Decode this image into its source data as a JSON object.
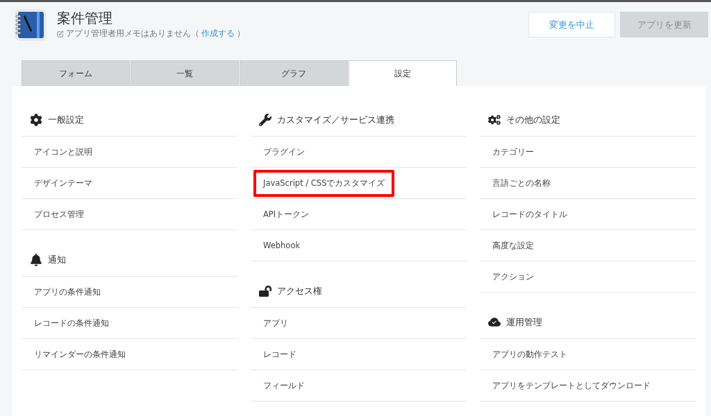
{
  "header": {
    "title": "案件管理",
    "memo": {
      "text": "アプリ管理者用メモはありません（",
      "link": "作成する",
      "suffix": "）"
    }
  },
  "buttons": [
    {
      "label": "変更を中止",
      "disabled": false
    },
    {
      "label": "アプリを更新",
      "disabled": true
    }
  ],
  "tabs": [
    {
      "label": "フォーム",
      "selected": false
    },
    {
      "label": "一覧",
      "selected": false
    },
    {
      "label": "グラフ",
      "selected": false
    },
    {
      "label": "設定",
      "selected": true
    }
  ],
  "columns": [
    {
      "sections": [
        {
          "title": "一般設定",
          "items": [
            {
              "label": "アイコンと説明",
              "highlighted": false
            },
            {
              "label": "デザインテーマ",
              "highlighted": false
            },
            {
              "label": "プロセス管理",
              "highlighted": false
            }
          ]
        },
        {
          "title": "通知",
          "items": [
            {
              "label": "アプリの条件通知",
              "highlighted": false
            },
            {
              "label": "レコードの条件通知",
              "highlighted": false
            },
            {
              "label": "リマインダーの条件通知",
              "highlighted": false
            }
          ]
        }
      ]
    },
    {
      "sections": [
        {
          "title": "カスタマイズ／サービス連携",
          "items": [
            {
              "label": "プラグイン",
              "highlighted": false
            },
            {
              "label": "JavaScript / CSSでカスタマイズ",
              "highlighted": true
            },
            {
              "label": "APIトークン",
              "highlighted": false
            },
            {
              "label": "Webhook",
              "highlighted": false
            }
          ]
        },
        {
          "title": "アクセス権",
          "items": [
            {
              "label": "アプリ",
              "highlighted": false
            },
            {
              "label": "レコード",
              "highlighted": false
            },
            {
              "label": "フィールド",
              "highlighted": false
            }
          ]
        }
      ]
    },
    {
      "sections": [
        {
          "title": "その他の設定",
          "items": [
            {
              "label": "カテゴリー",
              "highlighted": false
            },
            {
              "label": "言語ごとの名称",
              "highlighted": false
            },
            {
              "label": "レコードのタイトル",
              "highlighted": false
            },
            {
              "label": "高度な設定",
              "highlighted": false
            },
            {
              "label": "アクション",
              "highlighted": false
            }
          ]
        },
        {
          "title": "運用管理",
          "items": [
            {
              "label": "アプリの動作テスト",
              "highlighted": false
            },
            {
              "label": "アプリをテンプレートとしてダウンロード",
              "highlighted": false
            }
          ]
        }
      ]
    }
  ]
}
